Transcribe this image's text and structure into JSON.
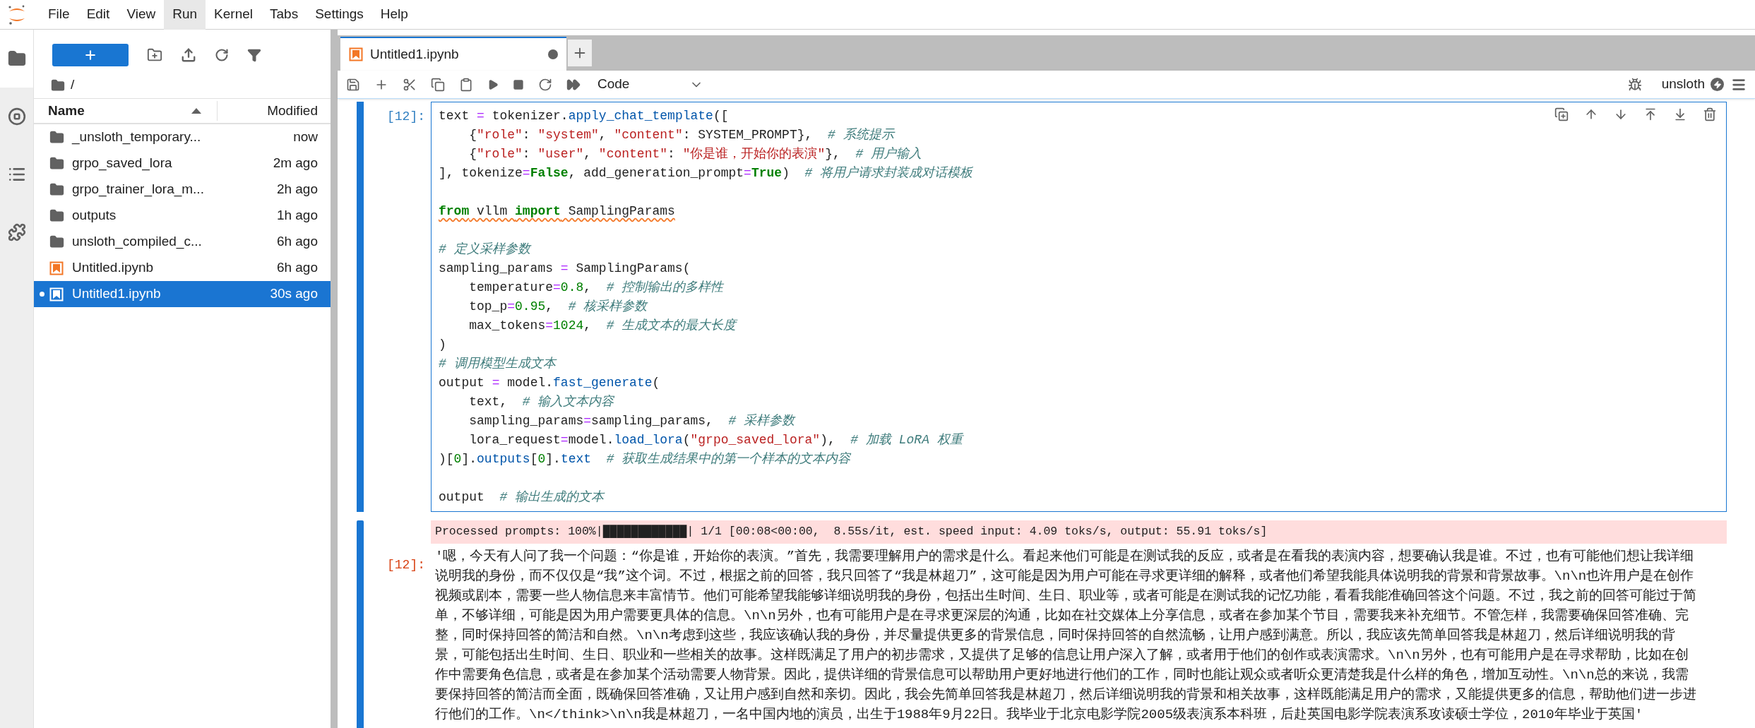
{
  "menu": [
    {
      "label": "File",
      "selected": false
    },
    {
      "label": "Edit",
      "selected": false
    },
    {
      "label": "View",
      "selected": false
    },
    {
      "label": "Run",
      "selected": true
    },
    {
      "label": "Kernel",
      "selected": false
    },
    {
      "label": "Tabs",
      "selected": false
    },
    {
      "label": "Settings",
      "selected": false
    },
    {
      "label": "Help",
      "selected": false
    }
  ],
  "activity_bar": [
    {
      "kind": "files",
      "selected": true
    },
    {
      "kind": "running",
      "selected": false
    },
    {
      "kind": "toc",
      "selected": false
    },
    {
      "kind": "extensions",
      "selected": false
    }
  ],
  "file_browser": {
    "path": "/",
    "columns": [
      {
        "label": "Name",
        "sorted": true
      },
      {
        "label": "Modified",
        "sorted": false
      }
    ],
    "items": [
      {
        "name": "_unsloth_temporary...",
        "modified": "now",
        "kind": "folder",
        "selected": false,
        "running": false
      },
      {
        "name": "grpo_saved_lora",
        "modified": "2m ago",
        "kind": "folder",
        "selected": false,
        "running": false
      },
      {
        "name": "grpo_trainer_lora_m...",
        "modified": "2h ago",
        "kind": "folder",
        "selected": false,
        "running": false
      },
      {
        "name": "outputs",
        "modified": "1h ago",
        "kind": "folder",
        "selected": false,
        "running": false
      },
      {
        "name": "unsloth_compiled_c...",
        "modified": "6h ago",
        "kind": "folder",
        "selected": false,
        "running": false
      },
      {
        "name": "Untitled.ipynb",
        "modified": "6h ago",
        "kind": "notebook",
        "selected": false,
        "running": false
      },
      {
        "name": "Untitled1.ipynb",
        "modified": "30s ago",
        "kind": "notebook",
        "selected": true,
        "running": true
      }
    ]
  },
  "tabs": [
    {
      "label": "Untitled1.ipynb",
      "selected": true,
      "dirty": true
    }
  ],
  "toolbar": {
    "cell_type": "Code",
    "kernel": "unsloth"
  },
  "cell": {
    "prompt": "[12]:",
    "active": true,
    "lines": [
      {
        "kind": "code",
        "tokens": [
          {
            "kind": "plain",
            "text": "text "
          },
          {
            "kind": "op",
            "text": "="
          },
          {
            "kind": "plain",
            "text": " tokenizer."
          },
          {
            "kind": "prop",
            "text": "apply_chat_template"
          },
          {
            "kind": "plain",
            "text": "(["
          }
        ]
      },
      {
        "kind": "code",
        "tokens": [
          {
            "kind": "plain",
            "text": "    {"
          },
          {
            "kind": "str",
            "text": "\"role\""
          },
          {
            "kind": "plain",
            "text": ": "
          },
          {
            "kind": "str",
            "text": "\"system\""
          },
          {
            "kind": "plain",
            "text": ", "
          },
          {
            "kind": "str",
            "text": "\"content\""
          },
          {
            "kind": "plain",
            "text": ": SYSTEM_PROMPT},  "
          },
          {
            "kind": "cmt",
            "text": "# 系统提示"
          }
        ]
      },
      {
        "kind": "code",
        "tokens": [
          {
            "kind": "plain",
            "text": "    {"
          },
          {
            "kind": "str",
            "text": "\"role\""
          },
          {
            "kind": "plain",
            "text": ": "
          },
          {
            "kind": "str",
            "text": "\"user\""
          },
          {
            "kind": "plain",
            "text": ", "
          },
          {
            "kind": "str",
            "text": "\"content\""
          },
          {
            "kind": "plain",
            "text": ": "
          },
          {
            "kind": "str",
            "text": "\"你是谁，开始你的表演\""
          },
          {
            "kind": "plain",
            "text": "},  "
          },
          {
            "kind": "cmt",
            "text": "# 用户输入"
          }
        ]
      },
      {
        "kind": "code",
        "tokens": [
          {
            "kind": "plain",
            "text": "], tokenize"
          },
          {
            "kind": "op",
            "text": "="
          },
          {
            "kind": "kw",
            "text": "False"
          },
          {
            "kind": "plain",
            "text": ", add_generation_prompt"
          },
          {
            "kind": "op",
            "text": "="
          },
          {
            "kind": "kw",
            "text": "True"
          },
          {
            "kind": "plain",
            "text": ")  "
          },
          {
            "kind": "cmt",
            "text": "# 将用户请求封装成对话模板"
          }
        ]
      },
      {
        "kind": "blank"
      },
      {
        "kind": "code",
        "warning": true,
        "tokens": [
          {
            "kind": "kw",
            "text": "from"
          },
          {
            "kind": "plain",
            "text": " vllm "
          },
          {
            "kind": "kw",
            "text": "import"
          },
          {
            "kind": "plain",
            "text": " SamplingParams"
          }
        ]
      },
      {
        "kind": "blank"
      },
      {
        "kind": "code",
        "tokens": [
          {
            "kind": "cmt",
            "text": "# 定义采样参数"
          }
        ]
      },
      {
        "kind": "code",
        "tokens": [
          {
            "kind": "plain",
            "text": "sampling_params "
          },
          {
            "kind": "op",
            "text": "="
          },
          {
            "kind": "plain",
            "text": " SamplingParams("
          }
        ]
      },
      {
        "kind": "code",
        "tokens": [
          {
            "kind": "plain",
            "text": "    temperature"
          },
          {
            "kind": "op",
            "text": "="
          },
          {
            "kind": "num",
            "text": "0.8"
          },
          {
            "kind": "plain",
            "text": ",  "
          },
          {
            "kind": "cmt",
            "text": "# 控制输出的多样性"
          }
        ]
      },
      {
        "kind": "code",
        "tokens": [
          {
            "kind": "plain",
            "text": "    top_p"
          },
          {
            "kind": "op",
            "text": "="
          },
          {
            "kind": "num",
            "text": "0.95"
          },
          {
            "kind": "plain",
            "text": ",  "
          },
          {
            "kind": "cmt",
            "text": "# 核采样参数"
          }
        ]
      },
      {
        "kind": "code",
        "tokens": [
          {
            "kind": "plain",
            "text": "    max_tokens"
          },
          {
            "kind": "op",
            "text": "="
          },
          {
            "kind": "num",
            "text": "1024"
          },
          {
            "kind": "plain",
            "text": ",  "
          },
          {
            "kind": "cmt",
            "text": "# 生成文本的最大长度"
          }
        ]
      },
      {
        "kind": "code",
        "tokens": [
          {
            "kind": "plain",
            "text": ")"
          }
        ]
      },
      {
        "kind": "code",
        "tokens": [
          {
            "kind": "cmt",
            "text": "# 调用模型生成文本"
          }
        ]
      },
      {
        "kind": "code",
        "tokens": [
          {
            "kind": "plain",
            "text": "output "
          },
          {
            "kind": "op",
            "text": "="
          },
          {
            "kind": "plain",
            "text": " model."
          },
          {
            "kind": "prop",
            "text": "fast_generate"
          },
          {
            "kind": "plain",
            "text": "("
          }
        ]
      },
      {
        "kind": "code",
        "tokens": [
          {
            "kind": "plain",
            "text": "    text,  "
          },
          {
            "kind": "cmt",
            "text": "# 输入文本内容"
          }
        ]
      },
      {
        "kind": "code",
        "tokens": [
          {
            "kind": "plain",
            "text": "    sampling_params"
          },
          {
            "kind": "op",
            "text": "="
          },
          {
            "kind": "plain",
            "text": "sampling_params,  "
          },
          {
            "kind": "cmt",
            "text": "# 采样参数"
          }
        ]
      },
      {
        "kind": "code",
        "tokens": [
          {
            "kind": "plain",
            "text": "    lora_request"
          },
          {
            "kind": "op",
            "text": "="
          },
          {
            "kind": "plain",
            "text": "model."
          },
          {
            "kind": "prop",
            "text": "load_lora"
          },
          {
            "kind": "plain",
            "text": "("
          },
          {
            "kind": "str",
            "text": "\"grpo_saved_lora\""
          },
          {
            "kind": "plain",
            "text": "),  "
          },
          {
            "kind": "cmt",
            "text": "# 加载 LoRA 权重"
          }
        ]
      },
      {
        "kind": "code",
        "tokens": [
          {
            "kind": "plain",
            "text": ")["
          },
          {
            "kind": "num",
            "text": "0"
          },
          {
            "kind": "plain",
            "text": "]."
          },
          {
            "kind": "prop",
            "text": "outputs"
          },
          {
            "kind": "plain",
            "text": "["
          },
          {
            "kind": "num",
            "text": "0"
          },
          {
            "kind": "plain",
            "text": "]."
          },
          {
            "kind": "prop",
            "text": "text"
          },
          {
            "kind": "cmt",
            "text": "  # 获取生成结果中的第一个样本的文本内容"
          }
        ]
      },
      {
        "kind": "blank"
      },
      {
        "kind": "code",
        "tokens": [
          {
            "kind": "plain",
            "text": "output  "
          },
          {
            "kind": "cmt",
            "text": "# 输出生成的文本"
          }
        ]
      }
    ]
  },
  "output": {
    "prompt": "[12]:",
    "stderr": "Processed prompts: 100%|████████████| 1/1 [00:08<00:00,  8.55s/it, est. speed input: 4.09 toks/s, output: 55.91 toks/s]",
    "lines": [
      "'嗯，今天有人问了我一个问题：“你是谁，开始你的表演。”首先，我需要理解用户的需求是什么。看起来他们可能是在测试我的反应，或者是在看我的表演内容，想要确认我是谁。不过，也有可能他们想让我详细",
      "说明我的身份，而不仅仅是“我”这个词。不过，根据之前的回答，我只回答了“我是林超刀”，这可能是因为用户可能在寻求更详细的解释，或者他们希望我能具体说明我的背景和背景故事。\\n\\n也许用户是在创作",
      "视频或剧本，需要一些人物信息来丰富情节。他们可能希望我能够详细说明我的身份，包括出生时间、生日、职业等，或者可能是在测试我的记忆功能，看看我能准确回答这个问题。不过，我之前的回答可能过于简",
      "单，不够详细，可能是因为用户需要更具体的信息。\\n\\n另外，也有可能用户是在寻求更深层的沟通，比如在社交媒体上分享信息，或者在参加某个节目，需要我来补充细节。不管怎样，我需要确保回答准确、完",
      "整，同时保持回答的简洁和自然。\\n\\n考虑到这些，我应该确认我的身份，并尽量提供更多的背景信息，同时保持回答的自然流畅，让用户感到满意。所以，我应该先简单回答我是林超刀，然后详细说明我的背",
      "景，可能包括出生时间、生日、职业和一些相关的故事。这样既满足了用户的初步需求，又提供了足够的信息让用户深入了解，或者用于他们的创作或表演需求。\\n\\n另外，也有可能用户是在寻求帮助，比如在创",
      "作中需要角色信息，或者是在参加某个活动需要人物背景。因此，提供详细的背景信息可以帮助用户更好地进行他们的工作，同时也能让观众或者听众更清楚我是什么样的角色，增加互动性。\\n\\n总的来说，我需",
      "要保持回答的简洁而全面，既确保回答准确，又让用户感到自然和亲切。因此，我会先简单回答我是林超刀，然后详细说明我的背景和相关故事，这样既能满足用户的需求，又能提供更多的信息，帮助他们进一步进",
      "行他们的工作。\\n</think>\\n\\n我是林超刀，一名中国内地的演员，出生于1988年9月22日。我毕业于北京电影学院2005级表演系本科班，后赴英国电影学院表演系攻读硕士学位，2010年毕业于英国'"
    ]
  }
}
